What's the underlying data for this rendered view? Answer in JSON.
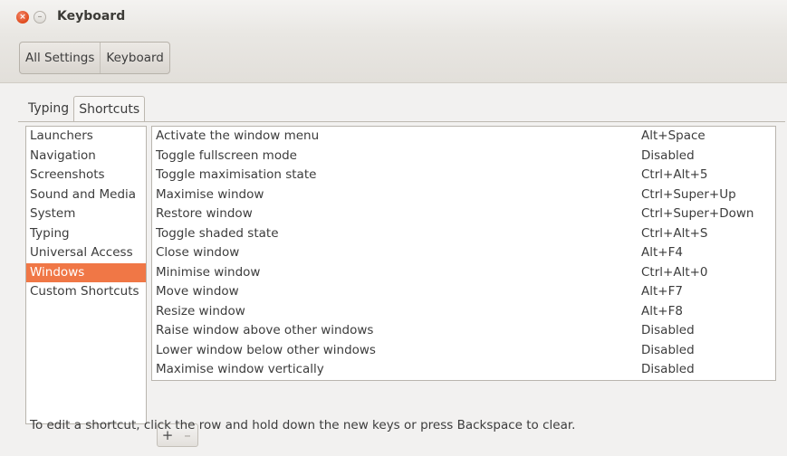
{
  "window": {
    "title": "Keyboard",
    "close_glyph": "×",
    "minimize_glyph": "–"
  },
  "toolbar": {
    "breadcrumbs": [
      "All Settings",
      "Keyboard"
    ]
  },
  "tabs": [
    {
      "label": "Typing",
      "active": false
    },
    {
      "label": "Shortcuts",
      "active": true
    }
  ],
  "categories": {
    "items": [
      "Launchers",
      "Navigation",
      "Screenshots",
      "Sound and Media",
      "System",
      "Typing",
      "Universal Access",
      "Windows",
      "Custom Shortcuts"
    ],
    "selected": "Windows",
    "selected_color": "#f07746"
  },
  "shortcuts": {
    "rows": [
      {
        "name": "Activate the window menu",
        "keys": "Alt+Space"
      },
      {
        "name": "Toggle fullscreen mode",
        "keys": "Disabled"
      },
      {
        "name": "Toggle maximisation state",
        "keys": "Ctrl+Alt+5"
      },
      {
        "name": "Maximise window",
        "keys": "Ctrl+Super+Up"
      },
      {
        "name": "Restore window",
        "keys": "Ctrl+Super+Down"
      },
      {
        "name": "Toggle shaded state",
        "keys": "Ctrl+Alt+S"
      },
      {
        "name": "Close window",
        "keys": "Alt+F4"
      },
      {
        "name": "Minimise window",
        "keys": "Ctrl+Alt+0"
      },
      {
        "name": "Move window",
        "keys": "Alt+F7"
      },
      {
        "name": "Resize window",
        "keys": "Alt+F8"
      },
      {
        "name": "Raise window above other windows",
        "keys": "Disabled"
      },
      {
        "name": "Lower window below other windows",
        "keys": "Disabled"
      },
      {
        "name": "Maximise window vertically",
        "keys": "Disabled"
      }
    ]
  },
  "buttons": {
    "add_label": "+",
    "remove_label": "–"
  },
  "hint": "To edit a shortcut, click the row and hold down the new keys or press Backspace to clear."
}
